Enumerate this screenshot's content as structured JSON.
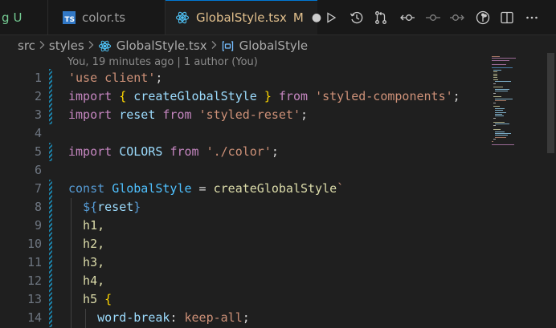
{
  "tabs": {
    "partial": {
      "label": "g",
      "status": "U"
    },
    "color": {
      "badge": "TS",
      "label": "color.ts"
    },
    "active": {
      "label": "GlobalStyle.tsx",
      "status": "M",
      "close": "●"
    }
  },
  "toolbar": {
    "icons": [
      "run-icon",
      "timeline-icon",
      "source-control-compare-icon",
      "go-back-icon",
      "commit-icon",
      "go-forward-icon",
      "gitlens-icon",
      "split-editor-icon",
      "more-actions-icon"
    ]
  },
  "breadcrumb": {
    "items": [
      "src",
      "styles",
      "GlobalStyle.tsx",
      "GlobalStyle"
    ]
  },
  "blame": "You, 19 minutes ago | 1 author (You)",
  "lines": [
    {
      "n": "1",
      "tokens": [
        [
          "'use client'",
          "str"
        ],
        [
          ";",
          "plain"
        ]
      ]
    },
    {
      "n": "2",
      "tokens": [
        [
          "import",
          "imp"
        ],
        [
          " ",
          "plain"
        ],
        [
          "{",
          "br1"
        ],
        [
          " ",
          "plain"
        ],
        [
          "createGlobalStyle",
          "var"
        ],
        [
          " ",
          "plain"
        ],
        [
          "}",
          "br1"
        ],
        [
          " ",
          "plain"
        ],
        [
          "from",
          "imp"
        ],
        [
          " ",
          "plain"
        ],
        [
          "'styled-components'",
          "str"
        ],
        [
          ";",
          "plain"
        ]
      ]
    },
    {
      "n": "3",
      "tokens": [
        [
          "import",
          "imp"
        ],
        [
          " ",
          "plain"
        ],
        [
          "reset",
          "var"
        ],
        [
          " ",
          "plain"
        ],
        [
          "from",
          "imp"
        ],
        [
          " ",
          "plain"
        ],
        [
          "'styled-reset'",
          "str"
        ],
        [
          ";",
          "plain"
        ]
      ]
    },
    {
      "n": "4",
      "tokens": []
    },
    {
      "n": "5",
      "tokens": [
        [
          "import",
          "imp"
        ],
        [
          " ",
          "plain"
        ],
        [
          "COLORS",
          "var"
        ],
        [
          " ",
          "plain"
        ],
        [
          "from",
          "imp"
        ],
        [
          " ",
          "plain"
        ],
        [
          "'./color'",
          "str"
        ],
        [
          ";",
          "plain"
        ]
      ]
    },
    {
      "n": "6",
      "tokens": []
    },
    {
      "n": "7",
      "tokens": [
        [
          "const",
          "kw"
        ],
        [
          " ",
          "plain"
        ],
        [
          "GlobalStyle",
          "cst"
        ],
        [
          " = ",
          "plain"
        ],
        [
          "createGlobalStyle",
          "fn"
        ],
        [
          "`",
          "str"
        ]
      ]
    },
    {
      "n": "8",
      "tokens": [
        [
          "  ",
          "plain"
        ],
        [
          "${",
          "kw"
        ],
        [
          "reset",
          "var"
        ],
        [
          "}",
          "kw"
        ]
      ]
    },
    {
      "n": "9",
      "tokens": [
        [
          "  h1,",
          "fn"
        ]
      ]
    },
    {
      "n": "10",
      "tokens": [
        [
          "  h2,",
          "fn"
        ]
      ]
    },
    {
      "n": "11",
      "tokens": [
        [
          "  h3,",
          "fn"
        ]
      ]
    },
    {
      "n": "12",
      "tokens": [
        [
          "  h4,",
          "fn"
        ]
      ]
    },
    {
      "n": "13",
      "tokens": [
        [
          "  h5 ",
          "fn"
        ],
        [
          "{",
          "br1"
        ]
      ]
    },
    {
      "n": "14",
      "tokens": [
        [
          "    ",
          "plain"
        ],
        [
          "word-break",
          "var"
        ],
        [
          ": ",
          "plain"
        ],
        [
          "keep-all",
          "str"
        ],
        [
          ";",
          "plain"
        ]
      ]
    }
  ],
  "modified_lines": [
    "1",
    "2",
    "3",
    "5",
    "7",
    "8",
    "9",
    "10",
    "11",
    "12",
    "13",
    "14"
  ],
  "colors": {
    "accent": "#0078d4",
    "modified_gutter": "#1b81a8",
    "untracked": "#73c991",
    "modified_tab": "#e2c08d"
  }
}
